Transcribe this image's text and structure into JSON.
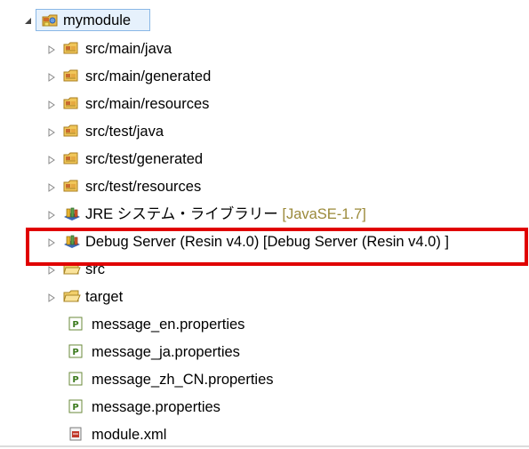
{
  "tree": {
    "root": {
      "label": "mymodule",
      "icon": "java-project-icon",
      "expanded": true
    },
    "items": [
      {
        "label": "src/main/java",
        "decoration": "",
        "icon": "source-folder-icon",
        "expandable": true
      },
      {
        "label": "src/main/generated",
        "decoration": "",
        "icon": "source-folder-icon",
        "expandable": true
      },
      {
        "label": "src/main/resources",
        "decoration": "",
        "icon": "source-folder-icon",
        "expandable": true
      },
      {
        "label": "src/test/java",
        "decoration": "",
        "icon": "source-folder-icon",
        "expandable": true
      },
      {
        "label": "src/test/generated",
        "decoration": "",
        "icon": "source-folder-icon",
        "expandable": true
      },
      {
        "label": "src/test/resources",
        "decoration": "",
        "icon": "source-folder-icon",
        "expandable": true
      },
      {
        "label": "JRE システム・ライブラリー",
        "decoration": "[JavaSE-1.7]",
        "icon": "library-icon",
        "expandable": true
      },
      {
        "label": "Debug Server (Resin v4.0) [Debug Server (Resin v4.0) ]",
        "decoration": "",
        "icon": "library-icon",
        "expandable": true
      },
      {
        "label": "src",
        "decoration": "",
        "icon": "folder-icon",
        "expandable": true
      },
      {
        "label": "target",
        "decoration": "",
        "icon": "folder-icon",
        "expandable": true
      },
      {
        "label": "message_en.properties",
        "decoration": "",
        "icon": "properties-file-icon",
        "expandable": false
      },
      {
        "label": "message_ja.properties",
        "decoration": "",
        "icon": "properties-file-icon",
        "expandable": false
      },
      {
        "label": "message_zh_CN.properties",
        "decoration": "",
        "icon": "properties-file-icon",
        "expandable": false
      },
      {
        "label": "message.properties",
        "decoration": "",
        "icon": "properties-file-icon",
        "expandable": false
      },
      {
        "label": "module.xml",
        "decoration": "",
        "icon": "xml-file-icon",
        "expandable": false
      }
    ]
  },
  "colors": {
    "highlight_border": "#e00000",
    "selection_bg": "#e6f1fc",
    "selection_border": "#8ab8e6",
    "decoration_text": "#9b8a3a"
  }
}
